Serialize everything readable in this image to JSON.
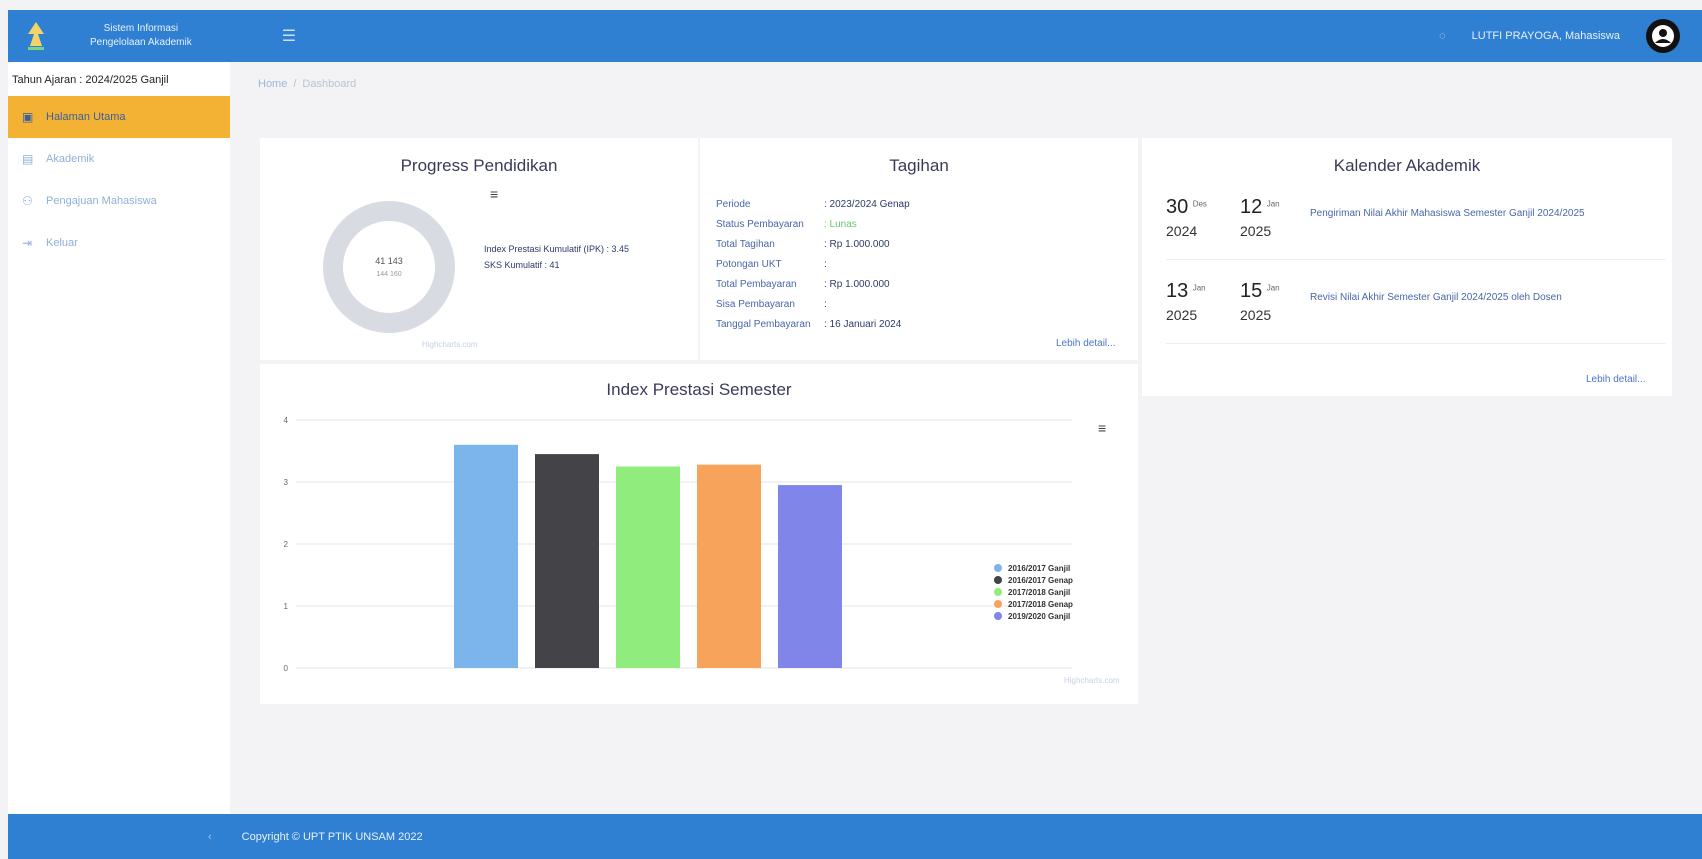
{
  "header": {
    "app_title_line1": "Sistem Informasi",
    "app_title_line2": "Pengelolaan Akademik",
    "user_label": "LUTFI PRAYOGA, Mahasiswa"
  },
  "sidebar": {
    "academic_year": "Tahun Ajaran : 2024/2025 Ganjil",
    "items": [
      {
        "label": "Halaman Utama",
        "icon": "dashboard-icon"
      },
      {
        "label": "Akademik",
        "icon": "document-icon"
      },
      {
        "label": "Pengajuan Mahasiswa",
        "icon": "users-icon"
      },
      {
        "label": "Keluar",
        "icon": "logout-icon"
      }
    ]
  },
  "breadcrumb": {
    "home": "Home",
    "current": "Dashboard"
  },
  "progress": {
    "title": "Progress Pendidikan",
    "donut_line1": "41 143",
    "donut_line2": "144 160",
    "ipk_text": "Index Prestasi Kumulatif (IPK) : 3.45",
    "sks_text": "SKS Kumulatif : 41",
    "credits": "Highcharts.com",
    "ring_color": "#d9dbe3"
  },
  "tagihan": {
    "title": "Tagihan",
    "rows": [
      {
        "label": "Periode",
        "value": ": 2023/2024 Genap"
      },
      {
        "label": "Status Pembayaran",
        "value": ": Lunas"
      },
      {
        "label": "Total Tagihan",
        "value": ": Rp 1.000.000"
      },
      {
        "label": "Potongan UKT",
        "value": ":"
      },
      {
        "label": "Total Pembayaran",
        "value": ": Rp 1.000.000"
      },
      {
        "label": "Sisa Pembayaran",
        "value": ":"
      },
      {
        "label": "Tanggal Pembayaran",
        "value": ": 16 Januari 2024"
      }
    ],
    "more": "Lebih detail..."
  },
  "kalender": {
    "title": "Kalender Akademik",
    "events": [
      {
        "d1": "30",
        "m1": "Des",
        "y1": "2024",
        "d2": "12",
        "m2": "Jan",
        "y2": "2025",
        "desc": "Pengiriman Nilai Akhir Mahasiswa Semester Ganjil 2024/2025"
      },
      {
        "d1": "13",
        "m1": "Jan",
        "y1": "2025",
        "d2": "15",
        "m2": "Jan",
        "y2": "2025",
        "desc": "Revisi Nilai Akhir Semester Ganjil 2024/2025 oleh Dosen"
      }
    ],
    "more": "Lebih detail..."
  },
  "chart_data": {
    "type": "bar",
    "title": "Index Prestasi Semester",
    "categories": [
      "2016/2017 Ganjil",
      "2016/2017 Genap",
      "2017/2018 Ganjil",
      "2017/2018 Genap",
      "2019/2020 Ganjil"
    ],
    "values": [
      3.6,
      3.45,
      3.25,
      3.28,
      2.95
    ],
    "colors": [
      "#7cb5ec",
      "#434348",
      "#90ed7d",
      "#f7a35c",
      "#8085e9"
    ],
    "ylim": [
      0,
      4
    ],
    "yticks": [
      "0",
      "1",
      "2",
      "3",
      "4"
    ],
    "grid": true,
    "legend": "right",
    "credits": "Highcharts.com"
  },
  "footer": {
    "copyright": "Copyright © UPT PTIK UNSAM 2022"
  }
}
